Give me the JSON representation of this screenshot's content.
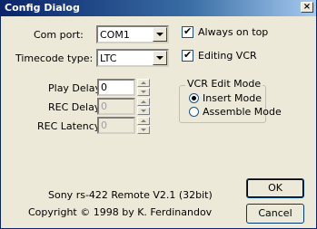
{
  "window": {
    "title": "Config Dialog",
    "close_glyph": "×"
  },
  "fields": {
    "com_port_label": "Com port:",
    "com_port_value": "COM1",
    "timecode_type_label": "Timecode type:",
    "timecode_type_value": "LTC",
    "play_delay_label": "Play Delay:",
    "play_delay_value": "0",
    "rec_delay_label": "REC Delay:",
    "rec_delay_value": "0",
    "rec_latency_label": "REC Latency:",
    "rec_latency_value": "0"
  },
  "options": {
    "always_on_top": {
      "label": "Always on top",
      "checked": true
    },
    "editing_vcr": {
      "label": "Editing VCR",
      "checked": true
    },
    "checkmark_glyph": "✔"
  },
  "vcr_edit_mode": {
    "title": "VCR Edit Mode",
    "insert_mode": "Insert Mode",
    "assemble_mode": "Assemble Mode",
    "selected": "Insert Mode"
  },
  "about": {
    "line1": "Sony rs-422 Remote V2.1 (32bit)",
    "line2": "Copyright © 1998 by K. Ferdinandov"
  },
  "buttons": {
    "ok": "OK",
    "cancel": "Cancel"
  }
}
